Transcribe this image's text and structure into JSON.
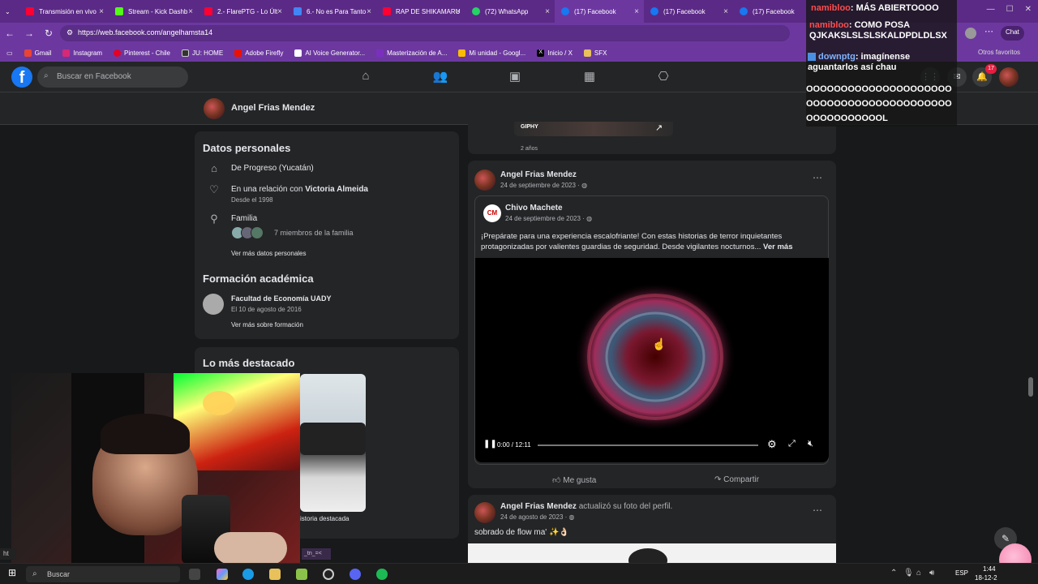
{
  "browser": {
    "tabs": [
      {
        "title": "Transmisión en vivo",
        "color": "#ff0033"
      },
      {
        "title": "Stream - Kick Dashb",
        "color": "#53fc18"
      },
      {
        "title": "2.- FlarePTG - Lo Últ",
        "color": "#ff0033"
      },
      {
        "title": "6.- No es Para Tanto",
        "color": "#4285f4"
      },
      {
        "title": "RAP DE SHIKAMARU",
        "color": "#ff0033"
      },
      {
        "title": "(72) WhatsApp",
        "color": "#25d366"
      },
      {
        "title": "(17) Facebook",
        "color": "#1877f2"
      },
      {
        "title": "(17) Facebook",
        "color": "#1877f2"
      },
      {
        "title": "(17) Facebook",
        "color": "#1877f2"
      }
    ],
    "url": "https://web.facebook.com/angelhamsta14",
    "bookmarks": [
      {
        "label": "Gmail",
        "color": "#ea4335"
      },
      {
        "label": "Instagram",
        "color": "#d62976"
      },
      {
        "label": "Pinterest - Chile",
        "color": "#e60023"
      },
      {
        "label": "JU: HOME",
        "color": "#333333"
      },
      {
        "label": "Adobe Firefly",
        "color": "#eb1000"
      },
      {
        "label": "AI Voice Generator...",
        "color": "#ffffff"
      },
      {
        "label": "Masterización de A...",
        "color": "#7b2fbf"
      },
      {
        "label": "Mi unidad - Googl...",
        "color": "#fbbc04"
      },
      {
        "label": "Inicio / X",
        "color": "#000000"
      },
      {
        "label": "SFX",
        "color": "#e8c15a"
      }
    ],
    "others_favorites": "Otros favoritos",
    "chat_label": "Chat"
  },
  "facebook": {
    "search_placeholder": "Buscar en Facebook",
    "notifications_count": "17",
    "profile_name": "Angel Frias Mendez"
  },
  "personal": {
    "title": "Datos personales",
    "hometown": "De Progreso (Yucatán)",
    "relationship_prefix": "En una relación con",
    "relationship_name": "Victoria Almeida",
    "relationship_since": "Desde el 1998",
    "family_title": "Familia",
    "family_count": "7 miembros de la familia",
    "see_more": "Ver más datos personales"
  },
  "education": {
    "title": "Formación académica",
    "school": "Facultad de Economía UADY",
    "date": "El 10 de agosto de 2016",
    "see_more": "Ver más sobre formación"
  },
  "highlights": {
    "title": "Lo más destacado",
    "item_label": "istoria destacada"
  },
  "prev_post": {
    "giphy": "GIPHY",
    "time": "2 años"
  },
  "post1": {
    "author": "Angel Frias Mendez",
    "date": "24 de septiembre de 2023 ·",
    "shared_author": "Chivo Machete",
    "shared_date": "24 de septiembre de 2023 ·",
    "text": "¡Prepárate para una experiencia escalofriante! Con estas historias de terror inquietantes protagonizadas por valientes guardias de seguridad. Desde vigilantes nocturnos...",
    "see_more": "Ver más",
    "video_time": "0:00 / 12:11",
    "progress": 0,
    "like": "Me gusta",
    "share": "Compartir"
  },
  "post2": {
    "author": "Angel Frias Mendez",
    "action": "actualizó su foto del perfil.",
    "date": "24 de agosto de 2023 ·",
    "text": "sobrado de flow ma' ✨👌🏻"
  },
  "chat_overlay": [
    {
      "user": "namibloo",
      "msg": ": MÁS ABIERTOOOO",
      "color": "#ff4d4d"
    },
    {
      "user": "namibloo",
      "msg": ": COMO POSA QJKAKSLSLSLSKALDPDLDLSX",
      "color": "#ff4d4d"
    },
    {
      "user": "downptg",
      "msg": ": imagínense aguantarlos así chau",
      "color": "#7fb4ff"
    },
    {
      "user": "",
      "msg": "OOOOOOOOOOOOOOOOOOOOOOOOOOOOOOOOOOOOOOOOOOOOOOOOOOOOOL",
      "color": "#ffffff"
    }
  ],
  "taskbar": {
    "search": "Buscar",
    "lang": "ESP",
    "time": "1:44",
    "date": "18-12-2"
  },
  "status_url": "ht",
  "status_chip": "_tn_=<"
}
